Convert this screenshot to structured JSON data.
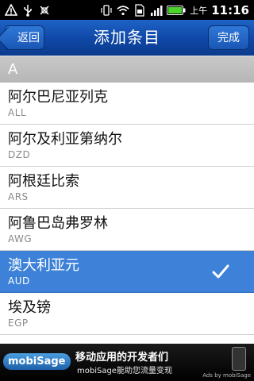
{
  "status_bar": {
    "left_icons": [
      "warning-icon",
      "usb-icon",
      "debug-icon"
    ],
    "right_icons": [
      "vibrate-icon",
      "wifi-icon",
      "sim-icon",
      "signal-icon",
      "battery-icon"
    ],
    "ampm": "上午",
    "time": "11:16"
  },
  "title_bar": {
    "back_label": "返回",
    "title": "添加条目",
    "done_label": "完成",
    "accent_color": "#1a56b4"
  },
  "section_header": "A",
  "items": [
    {
      "name": "阿尔巴尼亚列克",
      "code": "ALL",
      "selected": false
    },
    {
      "name": "阿尔及利亚第纳尔",
      "code": "DZD",
      "selected": false
    },
    {
      "name": "阿根廷比索",
      "code": "ARS",
      "selected": false
    },
    {
      "name": "阿鲁巴岛弗罗林",
      "code": "AWG",
      "selected": false
    },
    {
      "name": "澳大利亚元",
      "code": "AUD",
      "selected": true
    },
    {
      "name": "埃及镑",
      "code": "EGP",
      "selected": false
    }
  ],
  "ad": {
    "logo": "mobiSage",
    "line1": "移动应用的开发者们",
    "line2": "mobiSage能助您流量变现",
    "ads_by": "Ads by mobiSage"
  }
}
